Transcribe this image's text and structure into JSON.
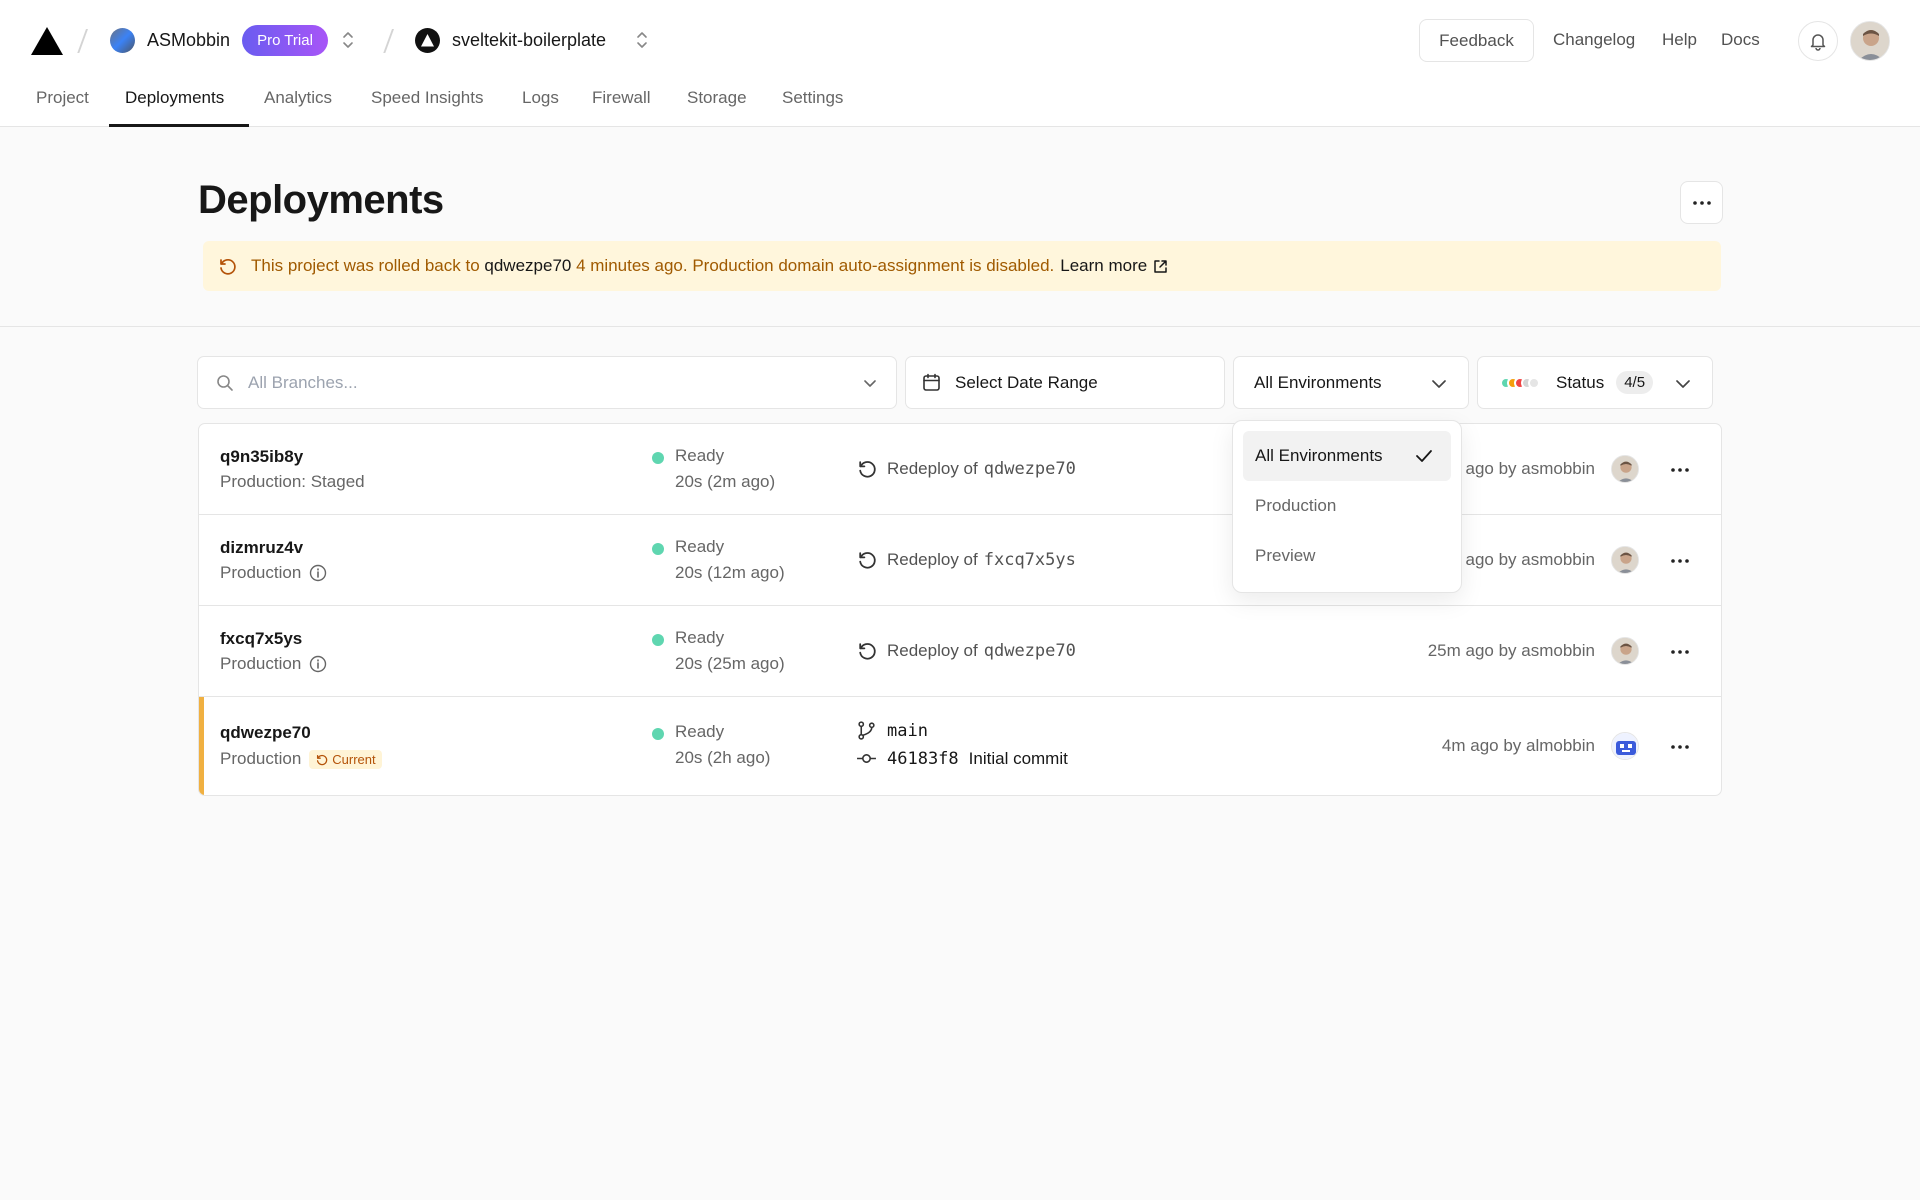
{
  "header": {
    "team_name": "ASMobbin",
    "plan_badge": "Pro Trial",
    "project_name": "sveltekit-boilerplate",
    "links": {
      "feedback": "Feedback",
      "changelog": "Changelog",
      "help": "Help",
      "docs": "Docs"
    }
  },
  "tabs": [
    {
      "label": "Project"
    },
    {
      "label": "Deployments",
      "active": true
    },
    {
      "label": "Analytics"
    },
    {
      "label": "Speed Insights"
    },
    {
      "label": "Logs"
    },
    {
      "label": "Firewall"
    },
    {
      "label": "Storage"
    },
    {
      "label": "Settings"
    }
  ],
  "page": {
    "title": "Deployments",
    "banner": {
      "prefix": "This project was rolled back to",
      "deployment": "qdwezpe70",
      "suffix": "4 minutes ago. Production domain auto-assignment is disabled.",
      "link": "Learn more"
    }
  },
  "filters": {
    "branches_placeholder": "All Branches...",
    "date_range": "Select Date Range",
    "environment": "All Environments",
    "status_label": "Status",
    "status_count": "4/5"
  },
  "environment_dropdown": {
    "options": [
      "All Environments",
      "Production",
      "Preview"
    ],
    "selected": "All Environments"
  },
  "deployments": [
    {
      "id": "q9n35ib8y",
      "environment": "Production: Staged",
      "status": "Ready",
      "duration": "20s (2m ago)",
      "source_prefix": "Redeploy of",
      "source_ref": "qdwezpe70",
      "meta": "ago by asmobbin"
    },
    {
      "id": "dizmruz4v",
      "environment": "Production",
      "status": "Ready",
      "duration": "20s (12m ago)",
      "source_prefix": "Redeploy of",
      "source_ref": "fxcq7x5ys",
      "meta": "ago by asmobbin"
    },
    {
      "id": "fxcq7x5ys",
      "environment": "Production",
      "status": "Ready",
      "duration": "20s (25m ago)",
      "source_prefix": "Redeploy of",
      "source_ref": "qdwezpe70",
      "meta": "25m ago by asmobbin"
    },
    {
      "id": "qdwezpe70",
      "environment": "Production",
      "badge": "Current",
      "status": "Ready",
      "duration": "20s (2h ago)",
      "branch": "main",
      "commit_hash": "46183f8",
      "commit_message": "Initial commit",
      "meta": "4m ago by almobbin"
    }
  ],
  "colors": {
    "ready": "#5fd6b0",
    "current_bar": "#f0b041",
    "banner_bg": "#fff6dc",
    "badge_gradient_start": "#6a5cf0",
    "badge_gradient_end": "#a855f7"
  }
}
